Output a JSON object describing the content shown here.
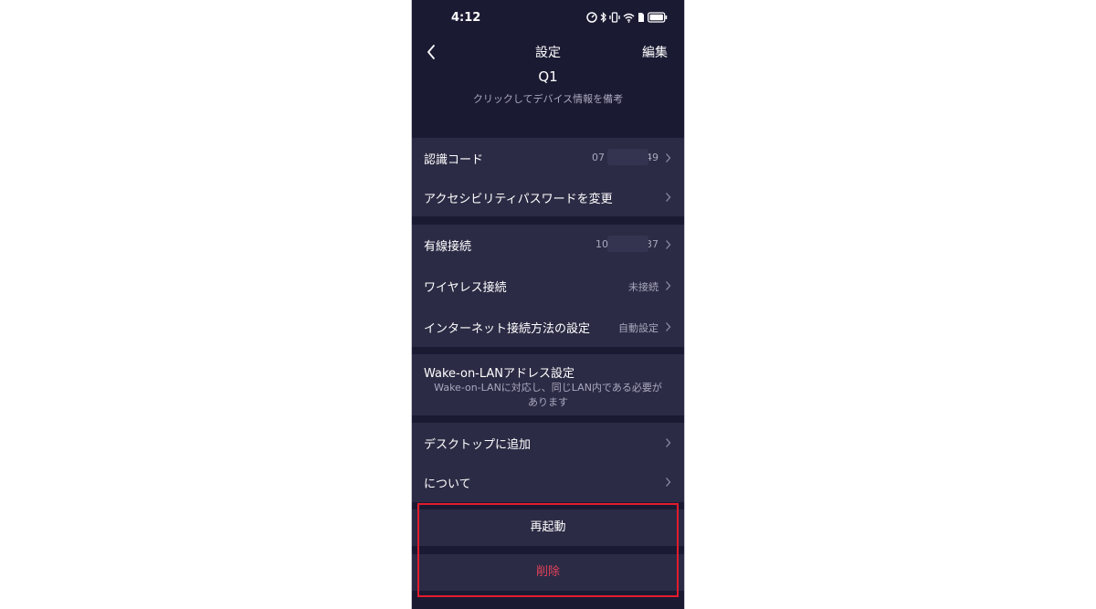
{
  "status_bar": {
    "time": "4:12"
  },
  "header": {
    "title": "設定",
    "edit_label": "編集",
    "device_name": "Q1",
    "device_note": "クリックしてデバイス情報を備考"
  },
  "groups": {
    "auth": {
      "code_label": "認識コード",
      "code_value_start": "07",
      "code_value_end": "49",
      "password_label": "アクセシビリティパスワードを変更"
    },
    "network": {
      "wired_label": "有線接続",
      "wired_value_start": "10",
      "wired_value_end": "37",
      "wireless_label": "ワイヤレス接続",
      "wireless_value": "未接続",
      "internet_label": "インターネット接続方法の設定",
      "internet_value": "自動設定"
    },
    "wol": {
      "title": "Wake-on-LANアドレス設定",
      "desc_line1": "Wake-on-LANに対応し、同じLAN内である必要が",
      "desc_line2": "あります"
    },
    "misc": {
      "desktop_label": "デスクトップに追加",
      "about_label": "について"
    }
  },
  "actions": {
    "restart_label": "再起動",
    "delete_label": "削除"
  },
  "colors": {
    "background": "#1b1a33",
    "card": "#2c2b45",
    "delete": "#e2425a",
    "highlight_border": "#e31b2c"
  }
}
